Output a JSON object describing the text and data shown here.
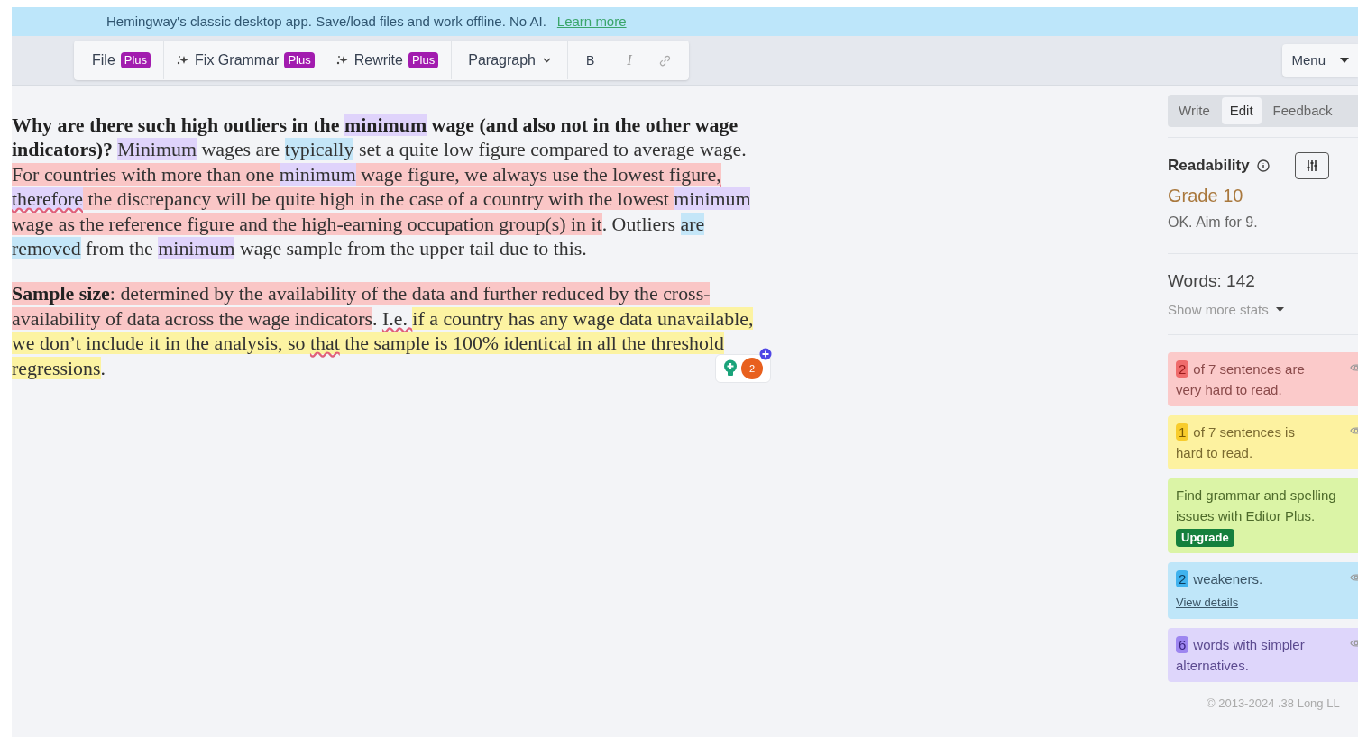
{
  "banner": {
    "text": "Hemingway's classic desktop app. Save/load files and work offline. No AI.",
    "link": "Learn more"
  },
  "toolbar": {
    "items": [
      {
        "kind": "plus",
        "label": "File",
        "badge": "Plus",
        "icon": false
      },
      {
        "kind": "plus",
        "label": "Fix Grammar",
        "badge": "Plus",
        "icon": true
      },
      {
        "kind": "plus",
        "label": "Rewrite",
        "badge": "Plus",
        "icon": true
      },
      {
        "kind": "dropdown",
        "label": "Paragraph"
      },
      {
        "kind": "bold",
        "label": "B"
      },
      {
        "kind": "italic",
        "label": "I"
      },
      {
        "kind": "link"
      }
    ],
    "menu": "Menu"
  },
  "editor": {
    "paragraphs": [
      {
        "segments": [
          {
            "text": "Why are there such high outliers in the ",
            "bold": true,
            "kind": "plain",
            "underline": false
          },
          {
            "text": "minimum",
            "bold": true,
            "kind": "simpler",
            "underline": false
          },
          {
            "text": " wage (and also not in the other wage indicators)? ",
            "bold": true,
            "kind": "plain",
            "underline": false
          },
          {
            "text": "Minimum",
            "bold": false,
            "kind": "simpler",
            "underline": false
          },
          {
            "text": " wages are ",
            "bold": false,
            "kind": "plain",
            "underline": false
          },
          {
            "text": "typically",
            "bold": false,
            "kind": "weakener",
            "underline": false
          },
          {
            "text": " set a quite low figure compared to average wage. ",
            "bold": false,
            "kind": "plain",
            "underline": false
          },
          {
            "text": "For countries with more than one ",
            "bold": false,
            "kind": "very_hard",
            "underline": false
          },
          {
            "text": "minimum",
            "bold": false,
            "kind": "simpler",
            "underline": false
          },
          {
            "text": " wage figure, we always use the lowest figure",
            "bold": false,
            "kind": "very_hard",
            "underline": false
          },
          {
            "text": ", ",
            "bold": false,
            "kind": "very_hard",
            "underline": true
          },
          {
            "text": "therefore",
            "bold": false,
            "kind": "simpler",
            "underline": true
          },
          {
            "text": " the discrepancy will be quite high in the case of a country with the lowest ",
            "bold": false,
            "kind": "very_hard",
            "underline": false
          },
          {
            "text": "minimum",
            "bold": false,
            "kind": "simpler",
            "underline": false
          },
          {
            "text": " wage as the reference figure and the high-earning occupation group(s) in it",
            "bold": false,
            "kind": "very_hard",
            "underline": false
          },
          {
            "text": ". Outliers ",
            "bold": false,
            "kind": "plain",
            "underline": false
          },
          {
            "text": "are removed",
            "bold": false,
            "kind": "weakener",
            "underline": false
          },
          {
            "text": " from the ",
            "bold": false,
            "kind": "plain",
            "underline": false
          },
          {
            "text": "minimum",
            "bold": false,
            "kind": "simpler",
            "underline": false
          },
          {
            "text": " wage sample from the upper tail due to this.",
            "bold": false,
            "kind": "plain",
            "underline": false
          }
        ]
      },
      {
        "segments": [
          {
            "text": "Sample size",
            "bold": true,
            "kind": "very_hard",
            "underline": false
          },
          {
            "text": ": determined by the availability of the data and further reduced by the cross-availability of data across the wage indicators",
            "bold": false,
            "kind": "very_hard",
            "underline": false
          },
          {
            "text": ". ",
            "bold": false,
            "kind": "plain",
            "underline": false
          },
          {
            "text": "I.e. ",
            "bold": false,
            "kind": "plain",
            "underline": true
          },
          {
            "text": "if a country has any wage data unavailable, we don’t include it in the analysis, so ",
            "bold": false,
            "kind": "hard",
            "underline": false
          },
          {
            "text": "that",
            "bold": false,
            "kind": "hard",
            "underline": true
          },
          {
            "text": " the sample is 100% identical in all the threshold regressions",
            "bold": false,
            "kind": "hard",
            "underline": false
          },
          {
            "text": ".",
            "bold": false,
            "kind": "plain",
            "underline": false
          }
        ]
      }
    ],
    "assistant_badge": "2"
  },
  "sidebar": {
    "tabs": [
      {
        "label": "Write",
        "selected": false
      },
      {
        "label": "Edit",
        "selected": true
      },
      {
        "label": "Feedback",
        "selected": false
      }
    ],
    "readability": {
      "title": "Readability",
      "grade": "Grade 10",
      "note": "OK. Aim for 9."
    },
    "words": "Words: 142",
    "more_stats": "Show more stats",
    "cards": [
      {
        "kind": "very_hard",
        "count": "2",
        "text": "of 7 sentences are very hard to read."
      },
      {
        "kind": "hard",
        "count": "1",
        "text": "of 7 sentences is hard to read."
      },
      {
        "kind": "promo",
        "text": "Find grammar and spelling issues with Editor Plus.",
        "button": "Upgrade"
      },
      {
        "kind": "weakener",
        "count": "2",
        "text": "weakeners.",
        "link": "View details"
      },
      {
        "kind": "simpler",
        "count": "6",
        "text": "words with simpler alternatives."
      }
    ],
    "footer": "© 2013-2024 .38 Long LL"
  }
}
